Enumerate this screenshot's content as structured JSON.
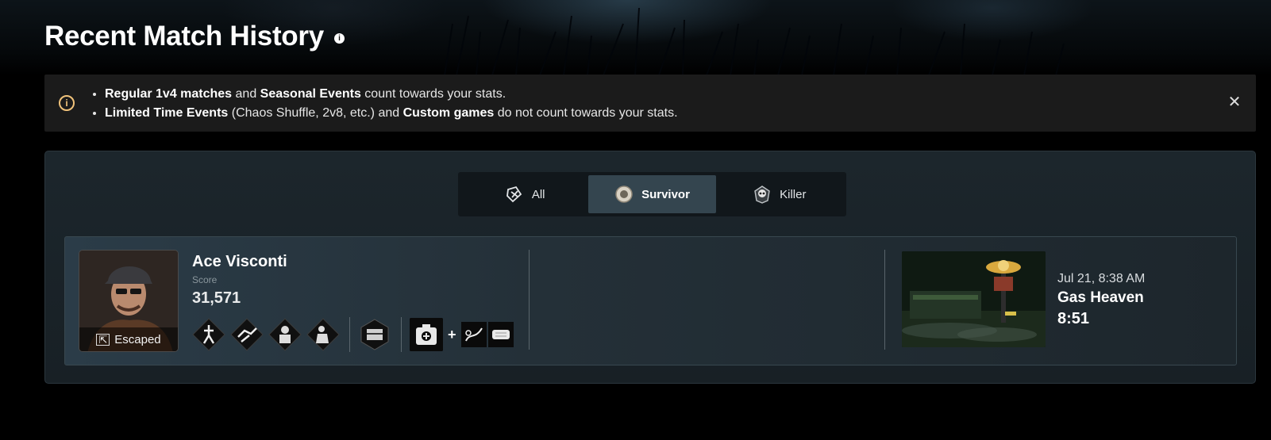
{
  "page": {
    "title": "Recent Match History",
    "title_info_icon": "info-icon"
  },
  "notice": {
    "icon": "info-circle-icon",
    "line1": {
      "b1": "Regular 1v4 matches",
      "t1": " and ",
      "b2": "Seasonal Events",
      "t2": " count towards your stats."
    },
    "line2": {
      "b1": "Limited Time Events",
      "t1": " (Chaos Shuffle, 2v8, etc.) and ",
      "b2": "Custom games",
      "t2": " do not count towards your stats."
    },
    "close_icon": "close-icon"
  },
  "tabs": [
    {
      "label": "All",
      "icon": "all-roles-icon",
      "active": false
    },
    {
      "label": "Survivor",
      "icon": "survivor-icon",
      "active": true
    },
    {
      "label": "Killer",
      "icon": "killer-skull-icon",
      "active": false
    }
  ],
  "match": {
    "character": "Ace Visconti",
    "status": "Escaped",
    "status_icon": "exit-door-icon",
    "score_label": "Score",
    "score": "31,571",
    "perks": [
      "perk-icon-1",
      "perk-icon-2",
      "perk-icon-3",
      "perk-icon-4"
    ],
    "offering": "offering-icon",
    "item": "medkit-icon",
    "addons": [
      "addon-icon-1",
      "addon-icon-2"
    ],
    "plus": "+",
    "date": "Jul 21, 8:38 AM",
    "map": "Gas Heaven",
    "duration": "8:51"
  },
  "colors": {
    "accent": "#f0c27a",
    "active_tab": "#34454f",
    "panel": "#1c262c",
    "notice_bg": "#1b1b1b"
  }
}
